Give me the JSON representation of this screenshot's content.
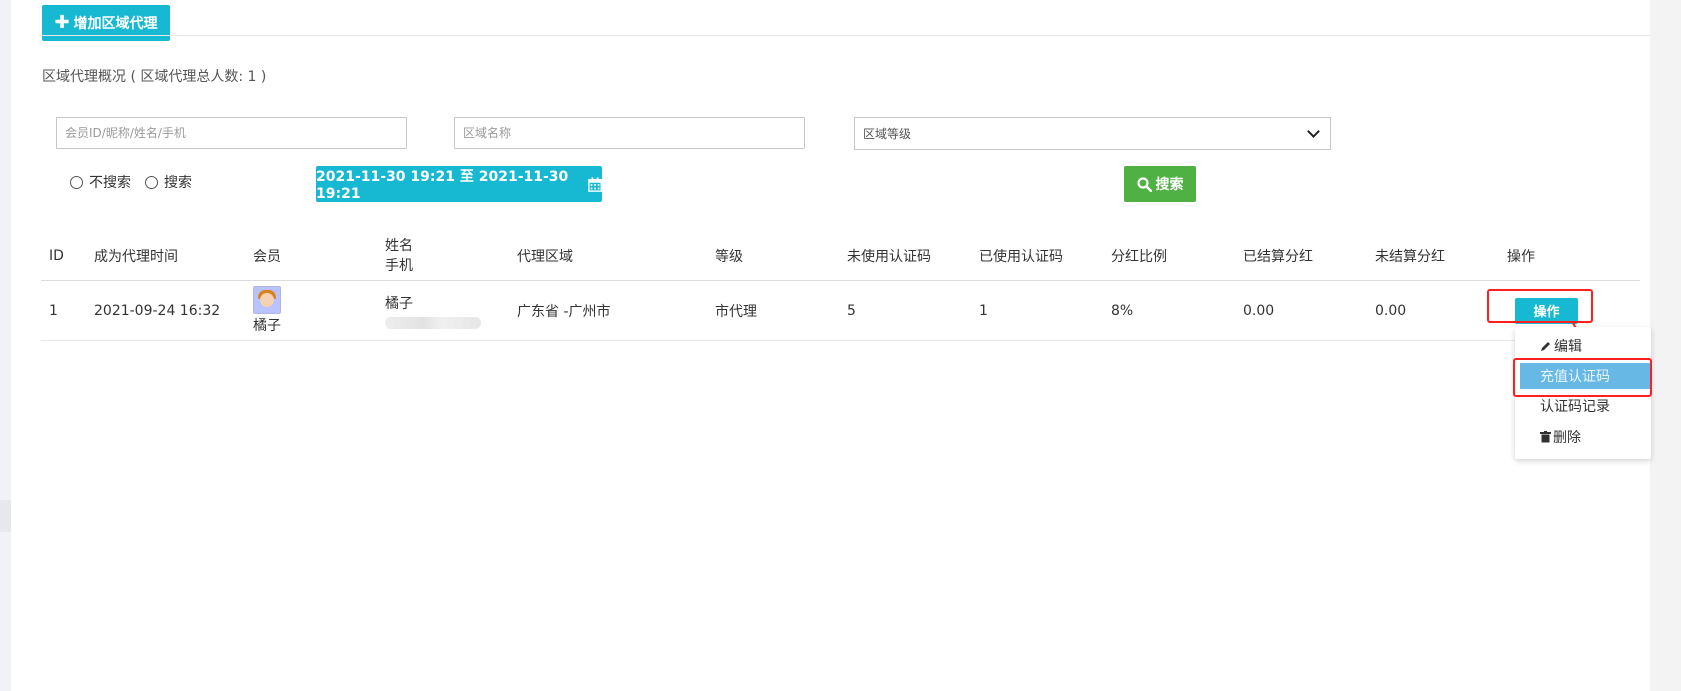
{
  "toolbar": {
    "add_agent_label": "增加区域代理"
  },
  "summary": {
    "text": "区域代理概况 ( 区域代理总人数: 1 )"
  },
  "filters": {
    "member_placeholder": "会员ID/昵称/姓名/手机",
    "region_placeholder": "区域名称",
    "level_selected": "区域等级",
    "radio_options": [
      "不搜索",
      "搜索"
    ],
    "date_range": "2021-11-30 19:21 至 2021-11-30 19:21",
    "search_label": "搜索"
  },
  "table": {
    "headers": {
      "id": "ID",
      "time": "成为代理时间",
      "member": "会员",
      "name": "姓名",
      "phone": "手机",
      "region": "代理区域",
      "level": "等级",
      "unused_codes": "未使用认证码",
      "used_codes": "已使用认证码",
      "ratio": "分红比例",
      "settled": "已结算分红",
      "unsettled": "未结算分红",
      "ops": "操作"
    },
    "rows": [
      {
        "id": "1",
        "time": "2021-09-24 16:32",
        "member": "橘子",
        "name": "橘子",
        "region": "广东省 -广州市",
        "level": "市代理",
        "unused_codes": "5",
        "used_codes": "1",
        "ratio": "8%",
        "settled": "0.00",
        "unsettled": "0.00",
        "ops_label": "操作"
      }
    ]
  },
  "dropdown": {
    "items": [
      "编辑",
      "充值认证码",
      "认证码记录",
      "删除"
    ]
  },
  "colors": {
    "accent": "#17b8d2",
    "search_green": "#4fb043",
    "highlight_red": "#ff1f1f",
    "menu_active": "#68b8e6"
  }
}
